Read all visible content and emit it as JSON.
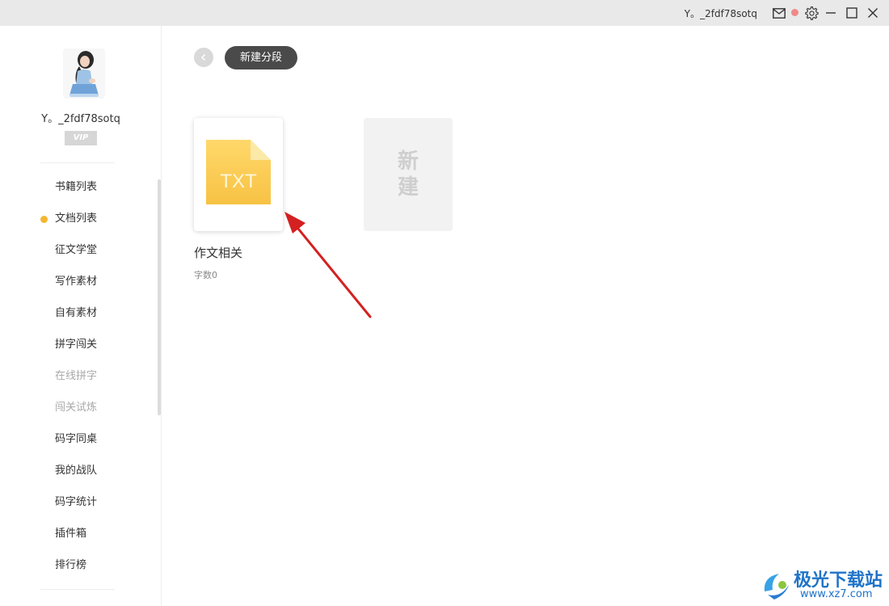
{
  "titlebar": {
    "username": "Y。_2fdf78sotq",
    "icons": [
      "mail-icon",
      "notification-badge",
      "gear-icon",
      "minimize-icon",
      "maximize-icon",
      "close-icon"
    ]
  },
  "sidebar": {
    "username": "Y。_2fdf78sotq",
    "vip_label": "VIP",
    "items": [
      {
        "label": "书籍列表",
        "state": "normal"
      },
      {
        "label": "文档列表",
        "state": "active"
      },
      {
        "label": "征文学堂",
        "state": "normal"
      },
      {
        "label": "写作素材",
        "state": "normal"
      },
      {
        "label": "自有素材",
        "state": "normal"
      },
      {
        "label": "拼字闯关",
        "state": "normal"
      },
      {
        "label": "在线拼字",
        "state": "disabled"
      },
      {
        "label": "闯关试炼",
        "state": "disabled"
      },
      {
        "label": "码字同桌",
        "state": "normal"
      },
      {
        "label": "我的战队",
        "state": "normal"
      },
      {
        "label": "码字统计",
        "state": "normal"
      },
      {
        "label": "插件箱",
        "state": "normal"
      },
      {
        "label": "排行榜",
        "state": "normal"
      }
    ],
    "active_dot_color": "#f5b731"
  },
  "main": {
    "new_segment_button": "新建分段",
    "document": {
      "icon_text": "TXT",
      "title": "作文相关",
      "word_count": "字数0"
    },
    "new_card": {
      "line1": "新",
      "line2": "建"
    }
  },
  "watermark": {
    "text": "极光下载站",
    "url": "www.xz7.com"
  },
  "colors": {
    "accent_yellow": "#f5b731",
    "button_dark": "#4a4a4a",
    "annotation_arrow": "#d42020"
  }
}
